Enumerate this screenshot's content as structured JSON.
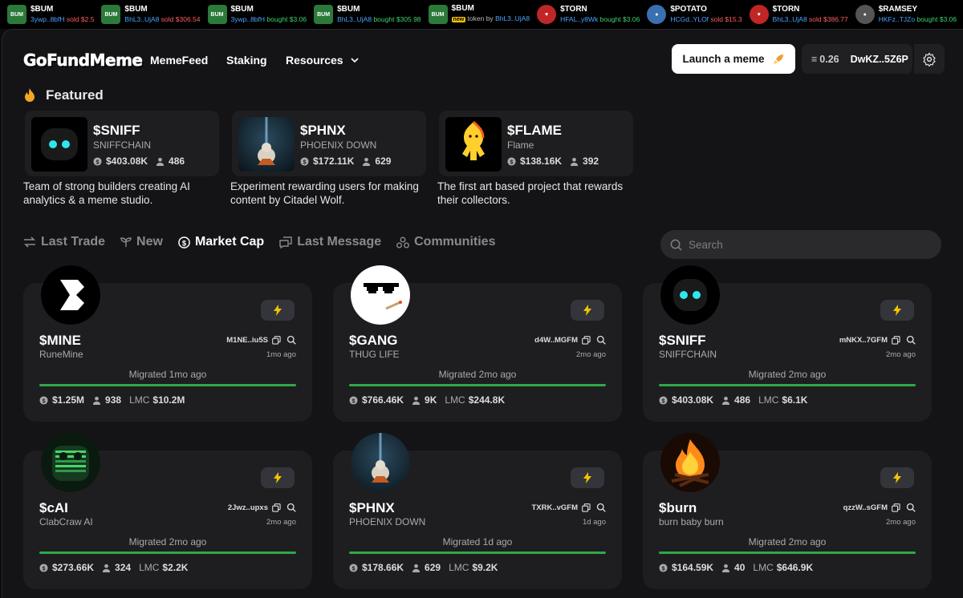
{
  "ticker": [
    {
      "sym": "$BUM",
      "addr": "3ywp..8bfH",
      "action": "sold",
      "amount": "$2.5",
      "av": "bum"
    },
    {
      "sym": "$BUM",
      "addr": "BhL3..UjA8",
      "action": "sold",
      "amount": "$306.54",
      "av": "bum"
    },
    {
      "sym": "$BUM",
      "addr": "3ywp..8bfH",
      "action": "bought",
      "amount": "$3.06",
      "av": "bum"
    },
    {
      "sym": "$BUM",
      "addr": "BhL3..UjA8",
      "action": "bought",
      "amount": "$305.98",
      "av": "bum"
    },
    {
      "sym": "$BUM",
      "new": "new",
      "action": "token by",
      "addr": "BhL3..UjA8",
      "av": "bum"
    },
    {
      "sym": "$TORN",
      "addr": "HFAL..y8Wk",
      "action": "bought",
      "amount": "$3.06",
      "av": "torn"
    },
    {
      "sym": "$POTATO",
      "addr": "HCGd..YLOf",
      "action": "sold",
      "amount": "$15.3",
      "av": "potato"
    },
    {
      "sym": "$TORN",
      "addr": "BhL3..UjA8",
      "action": "sold",
      "amount": "$386.77",
      "av": "torn"
    },
    {
      "sym": "$RAMSEY",
      "addr": "HKFz..TJZo",
      "action": "bought",
      "amount": "$3.06",
      "av": "ramsey"
    }
  ],
  "header": {
    "logo": "GoFundMeme",
    "nav": {
      "memefeed": "MemeFeed",
      "staking": "Staking",
      "resources": "Resources"
    },
    "launch_label": "Launch a meme",
    "balance": "0.26",
    "wallet": "DwKZ..5Z6P"
  },
  "featured": {
    "title": "Featured",
    "items": [
      {
        "sym": "$SNIFF",
        "name": "SNIFFCHAIN",
        "mcap": "$403.08K",
        "holders": "486",
        "desc": "Team of strong builders creating AI analytics & a meme studio.",
        "img": "sniff"
      },
      {
        "sym": "$PHNX",
        "name": "PHOENIX DOWN",
        "mcap": "$172.11K",
        "holders": "629",
        "desc": "Experiment rewarding users for making content by Citadel Wolf.",
        "img": "phnx"
      },
      {
        "sym": "$FLAME",
        "name": "Flame",
        "mcap": "$138.16K",
        "holders": "392",
        "desc": "The first art based project that rewards their collectors.",
        "img": "flame"
      }
    ]
  },
  "tabs": {
    "last_trade": "Last Trade",
    "new": "New",
    "market_cap": "Market Cap",
    "last_message": "Last Message",
    "communities": "Communities"
  },
  "search": {
    "placeholder": "Search"
  },
  "cards": [
    {
      "sym": "$MINE",
      "name": "RuneMine",
      "addr": "M1NE..iu5S",
      "time": "1mo ago",
      "migrated": "Migrated 1mo ago",
      "mcap": "$1.25M",
      "holders": "938",
      "lmc_label": "LMC",
      "lmc": "$10.2M",
      "img": "mine"
    },
    {
      "sym": "$GANG",
      "name": "THUG LIFE",
      "addr": "d4W..MGFM",
      "time": "2mo ago",
      "migrated": "Migrated 2mo ago",
      "mcap": "$766.46K",
      "holders": "9K",
      "lmc_label": "LMC",
      "lmc": "$244.8K",
      "img": "gang"
    },
    {
      "sym": "$SNIFF",
      "name": "SNIFFCHAIN",
      "addr": "mNKX..7GFM",
      "time": "2mo ago",
      "migrated": "Migrated 2mo ago",
      "mcap": "$403.08K",
      "holders": "486",
      "lmc_label": "LMC",
      "lmc": "$6.1K",
      "img": "sniff"
    },
    {
      "sym": "$cAI",
      "name": "ClabCraw AI",
      "addr": "2Jwz..upxs",
      "time": "2mo ago",
      "migrated": "Migrated 2mo ago",
      "mcap": "$273.66K",
      "holders": "324",
      "lmc_label": "LMC",
      "lmc": "$2.2K",
      "img": "cai"
    },
    {
      "sym": "$PHNX",
      "name": "PHOENIX DOWN",
      "addr": "TXRK..vGFM",
      "time": "1d ago",
      "migrated": "Migrated 1d ago",
      "mcap": "$178.66K",
      "holders": "629",
      "lmc_label": "LMC",
      "lmc": "$9.2K",
      "img": "phnx"
    },
    {
      "sym": "$burn",
      "name": "burn baby burn",
      "addr": "qzzW..sGFM",
      "time": "2mo ago",
      "migrated": "Migrated 2mo ago",
      "mcap": "$164.59K",
      "holders": "40",
      "lmc_label": "LMC",
      "lmc": "$646.9K",
      "img": "burn"
    }
  ]
}
